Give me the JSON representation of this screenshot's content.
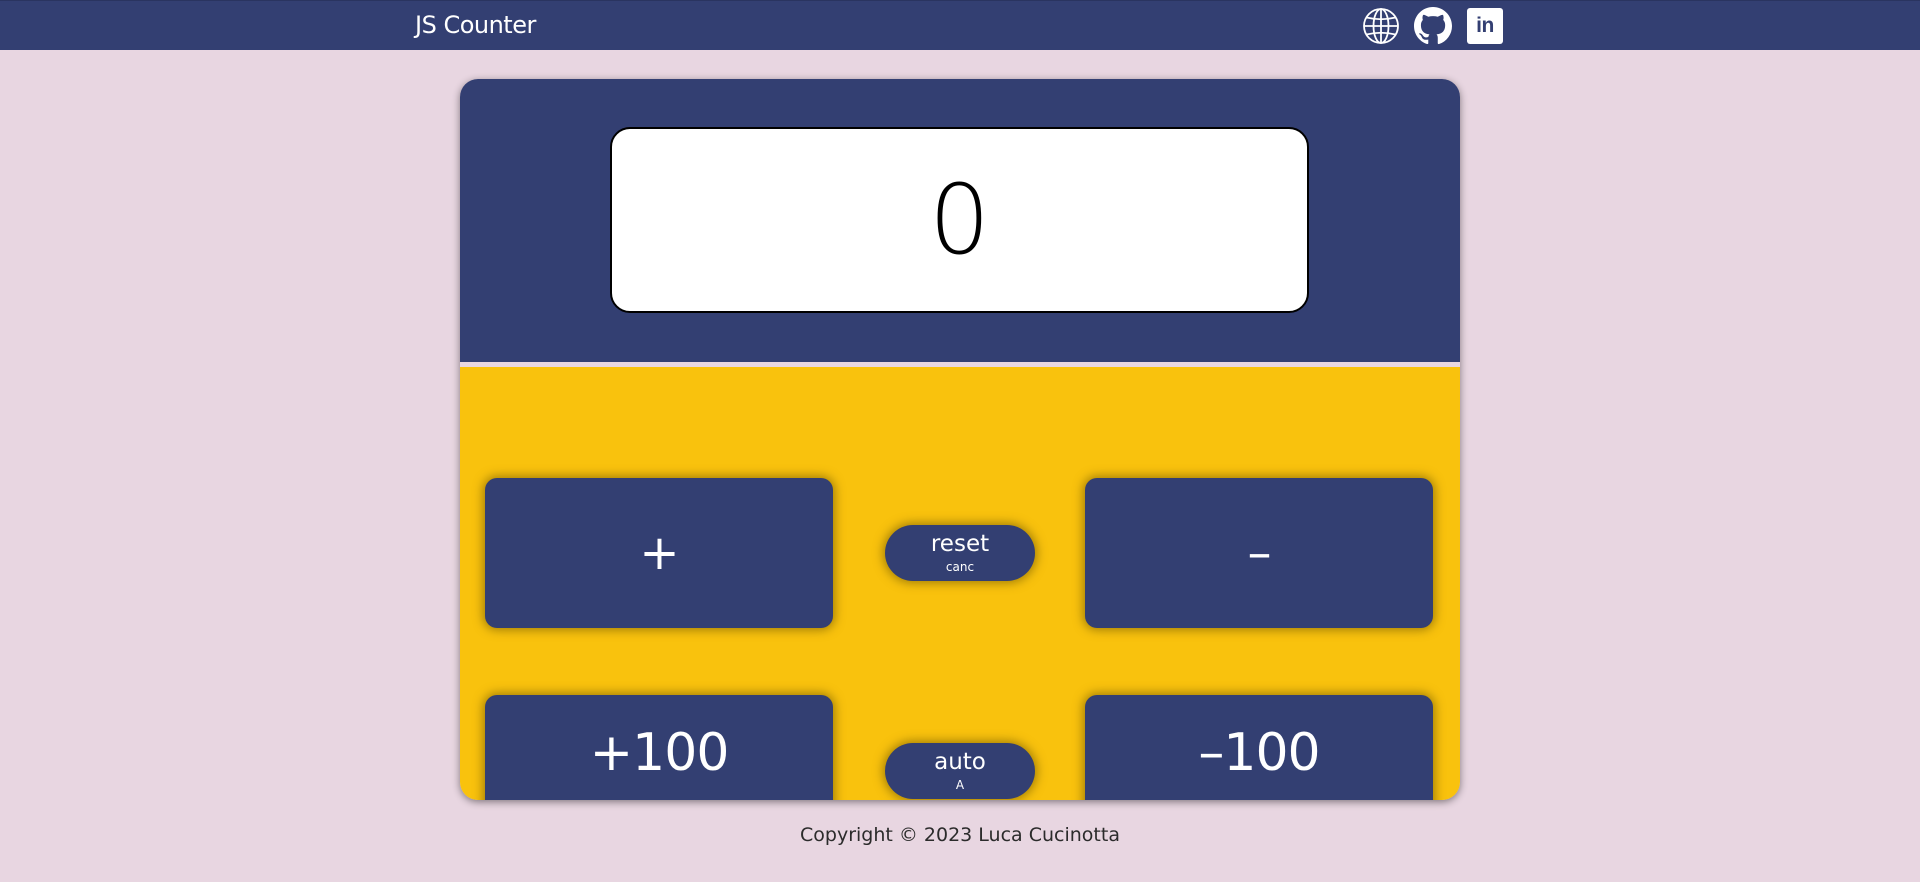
{
  "header": {
    "title": "JS Counter",
    "icons": {
      "website": "globe-icon",
      "github": "github-icon",
      "linkedin": "linkedin-icon",
      "linkedin_text": "in"
    }
  },
  "counter": {
    "value": "0"
  },
  "buttons": {
    "plus": {
      "label": "+",
      "key": ""
    },
    "minus": {
      "label": "–",
      "key": ""
    },
    "reset": {
      "label": "reset",
      "key": "canc"
    },
    "plus100": {
      "label": "+100",
      "key": "↑"
    },
    "minus100": {
      "label": "–100",
      "key": "↓"
    },
    "auto": {
      "label": "auto",
      "key": "A"
    }
  },
  "footer": {
    "copyright": "Copyright © 2023 Luca Cucinotta"
  },
  "colors": {
    "primary": "#333f72",
    "accent": "#f9c20d",
    "background": "#e8d6e1",
    "screen": "#ffffff"
  }
}
